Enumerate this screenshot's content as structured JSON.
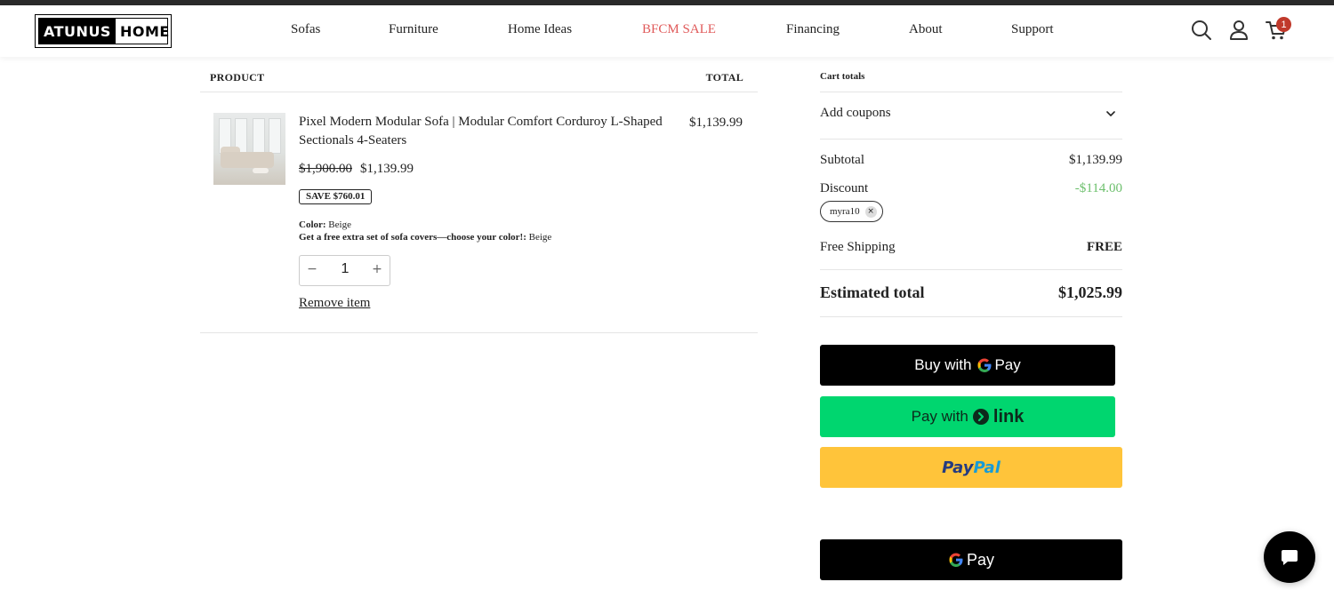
{
  "header": {
    "logo_part1": "ATUNUS",
    "logo_part2": "HOME",
    "nav": [
      "Sofas",
      "Furniture",
      "Home Ideas",
      "BFCM SALE",
      "Financing",
      "About",
      "Support"
    ],
    "cart_count": "1",
    "icons": [
      "search-icon",
      "user-icon",
      "cart-icon"
    ],
    "sale_color": "#e05a5a"
  },
  "product_table": {
    "col_product": "PRODUCT",
    "col_total": "TOTAL",
    "item": {
      "name": "Pixel Modern Modular Sofa | Modular Comfort Corduroy L-Shaped Sectionals 4-Seaters",
      "line_total": "$1,139.99",
      "price_old": "$1,900.00",
      "price_new": "$1,139.99",
      "save_badge": "SAVE $760.01",
      "option1_label": "Color:",
      "option1_value": "Beige",
      "option2_label": "Get a free extra set of sofa covers—choose your color!:",
      "option2_value": "Beige",
      "quantity": "1",
      "minus": "−",
      "plus": "+",
      "remove_label": "Remove item"
    }
  },
  "cart_totals": {
    "title": "Cart totals",
    "add_coupons": "Add coupons",
    "subtotal_label": "Subtotal",
    "subtotal_value": "$1,139.99",
    "discount_label": "Discount",
    "discount_value": "-$114.00",
    "coupon_code": "myra10",
    "coupon_remove": "×",
    "shipping_label": "Free Shipping",
    "shipping_value": "FREE",
    "estimated_label": "Estimated total",
    "estimated_value": "$1,025.99",
    "discount_color": "#6cbf6c"
  },
  "payments": {
    "gpay_label": "Buy with",
    "gpay_word": "Pay",
    "link_label": "Pay with",
    "link_word": "link",
    "paypal_a": "Pay",
    "paypal_b": "Pal",
    "gpay2_word": "Pay",
    "link_color": "#00d66f",
    "paypal_color": "#ffc43a"
  },
  "chat": {
    "icon": "chat-icon"
  }
}
